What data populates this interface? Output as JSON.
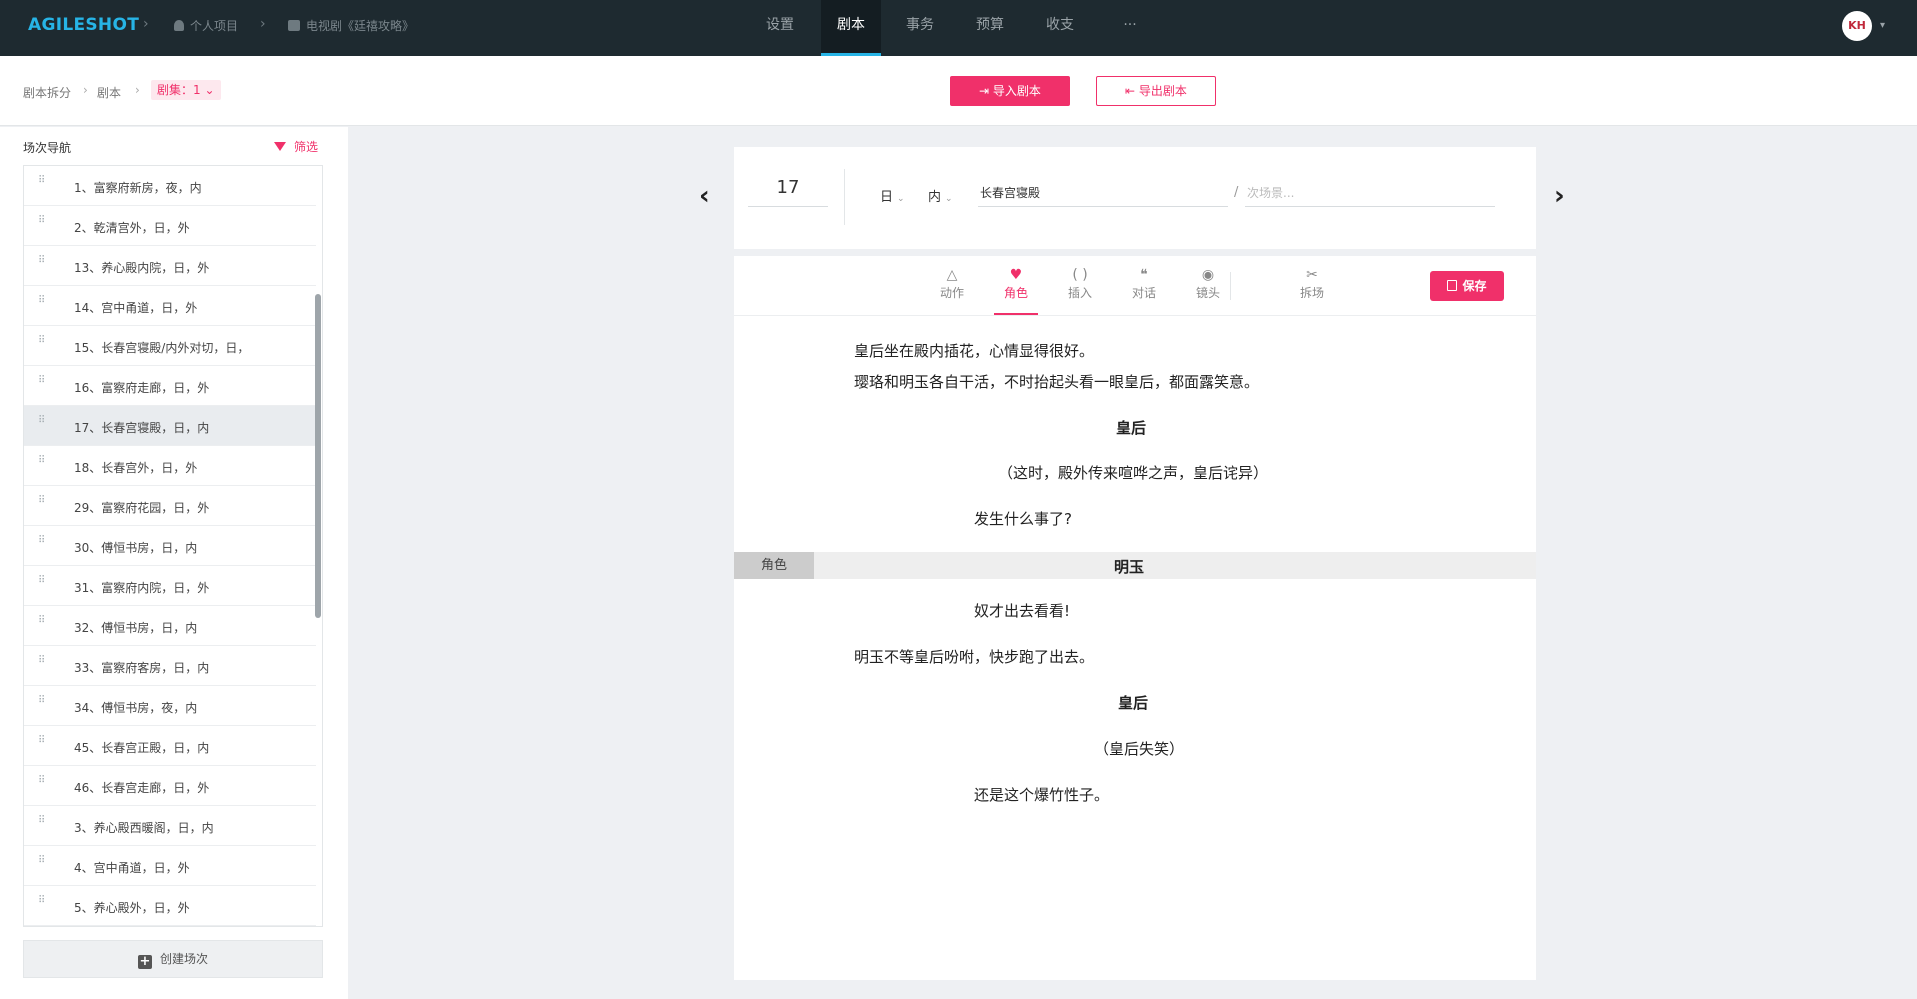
{
  "app": {
    "logo": "AGILESHOT",
    "crumb_project": "个人项目",
    "crumb_show": "电视剧《廷禧攻略》",
    "nav": [
      "设置",
      "剧本",
      "事务",
      "预算",
      "收支",
      "···"
    ],
    "active_nav": "剧本",
    "avatar_initials": "KH",
    "colors": {
      "accent": "#f0306a",
      "topbar": "#1e2a30",
      "brand": "#27b4e6"
    }
  },
  "subheader": {
    "breadcrumb": [
      "剧本拆分",
      "剧本"
    ],
    "episode": "剧集：1",
    "import_label": "导入剧本",
    "export_label": "导出剧本"
  },
  "sidebar": {
    "title": "场次导航",
    "filter_label": "筛选",
    "scenes": [
      "1、富察府新房，夜，内",
      "2、乾清宫外，日，外",
      "13、养心殿内院，日，外",
      "14、宫中甬道，日，外",
      "15、长春宫寝殿/内外对切，日，",
      "16、富察府走廊，日，外",
      "17、长春宫寝殿，日，内",
      "18、长春宫外，日，外",
      "29、富察府花园，日，外",
      "30、傅恒书房，日，内",
      "31、富察府内院，日，外",
      "32、傅恒书房，日，内",
      "33、富察府客房，日，内",
      "34、傅恒书房，夜，内",
      "45、长春宫正殿，日，内",
      "46、长春宫走廊，日，外",
      "3、养心殿西暖阁，日，内",
      "4、宫中甬道，日，外",
      "5、养心殿外，日，外"
    ],
    "selected_scene": "17、长春宫寝殿，日，内",
    "create_label": "创建场次"
  },
  "scene_header": {
    "number": "17",
    "time": "日",
    "place_type": "内",
    "location": "长春宫寝殿",
    "sub_location_placeholder": "次场景..."
  },
  "toolbar": {
    "tools": [
      {
        "label": "动作",
        "icon": "triangle-icon"
      },
      {
        "label": "角色",
        "icon": "character-icon"
      },
      {
        "label": "插入",
        "icon": "parentheses-icon"
      },
      {
        "label": "对话",
        "icon": "quote-icon"
      },
      {
        "label": "镜头",
        "icon": "camera-icon"
      },
      {
        "label": "拆场",
        "icon": "scissors-icon"
      }
    ],
    "active_tool": "角色",
    "save_label": "保存"
  },
  "script": {
    "action1": "皇后坐在殿内插花，心情显得很好。",
    "action2": "璎珞和明玉各自干活，不时抬起头看一眼皇后，都面露笑意。",
    "char1": "皇后",
    "paren1": "（这时，殿外传来喧哗之声，皇后诧异）",
    "dialog1": "发生什么事了?",
    "role_tag": "角色",
    "char2": "明玉",
    "dialog2": "奴才出去看看!",
    "action3": "明玉不等皇后吩咐，快步跑了出去。",
    "char3": "皇后",
    "paren2": "（皇后失笑）",
    "dialog3": "还是这个爆竹性子。"
  }
}
